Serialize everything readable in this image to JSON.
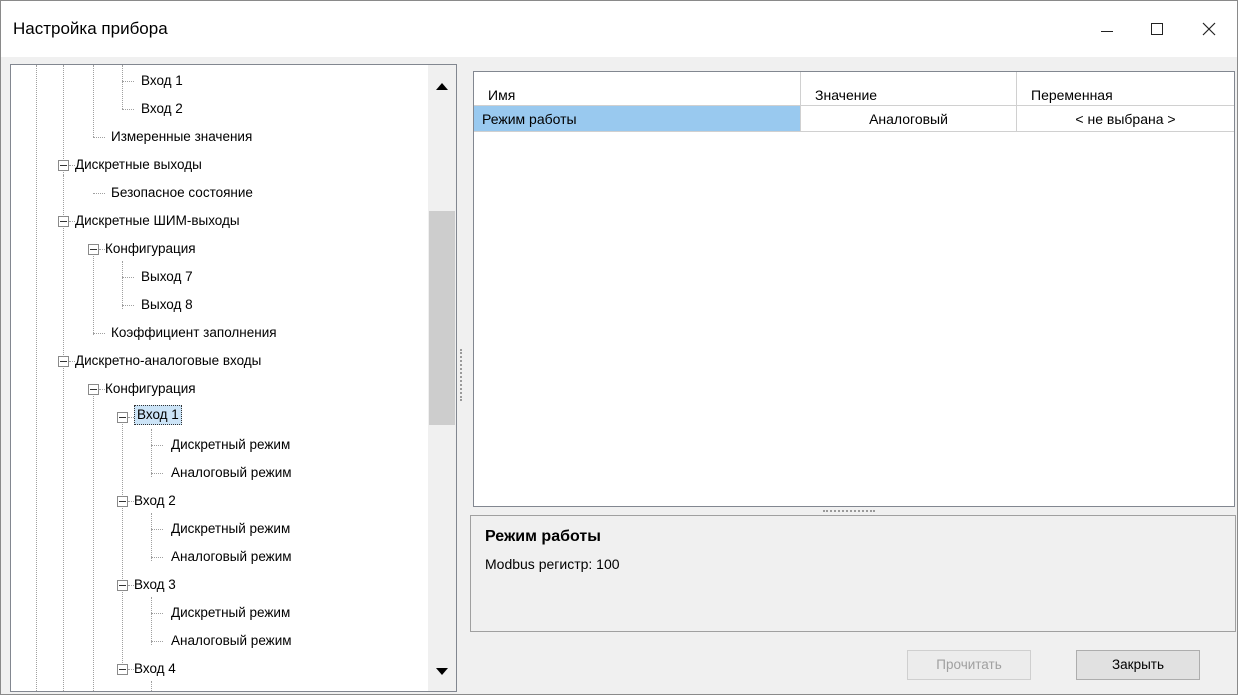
{
  "window": {
    "title": "Настройка прибора"
  },
  "tree": {
    "items": [
      {
        "label": "Вход 1"
      },
      {
        "label": "Вход 2"
      },
      {
        "label": "Измеренные значения"
      },
      {
        "label": "Дискретные выходы"
      },
      {
        "label": "Безопасное состояние"
      },
      {
        "label": "Дискретные ШИМ-выходы"
      },
      {
        "label": "Конфигурация"
      },
      {
        "label": "Выход 7"
      },
      {
        "label": "Выход 8"
      },
      {
        "label": "Коэффициент заполнения"
      },
      {
        "label": "Дискретно-аналоговые входы"
      },
      {
        "label": "Конфигурация"
      },
      {
        "label": "Вход 1"
      },
      {
        "label": "Дискретный режим"
      },
      {
        "label": "Аналоговый режим"
      },
      {
        "label": "Вход 2"
      },
      {
        "label": "Дискретный режим"
      },
      {
        "label": "Аналоговый режим"
      },
      {
        "label": "Вход 3"
      },
      {
        "label": "Дискретный режим"
      },
      {
        "label": "Аналоговый режим"
      },
      {
        "label": "Вход 4"
      }
    ],
    "selected_label": "Вход 1"
  },
  "grid": {
    "columns": [
      "Имя",
      "Значение",
      "Переменная"
    ],
    "rows": [
      {
        "name": "Режим работы",
        "value": "Аналоговый",
        "variable": "< не выбрана >"
      }
    ],
    "selected_color": "#99c9ef"
  },
  "description": {
    "title": "Режим работы",
    "text": "Modbus регистр: 100"
  },
  "buttons": {
    "read": "Прочитать",
    "close": "Закрыть"
  }
}
